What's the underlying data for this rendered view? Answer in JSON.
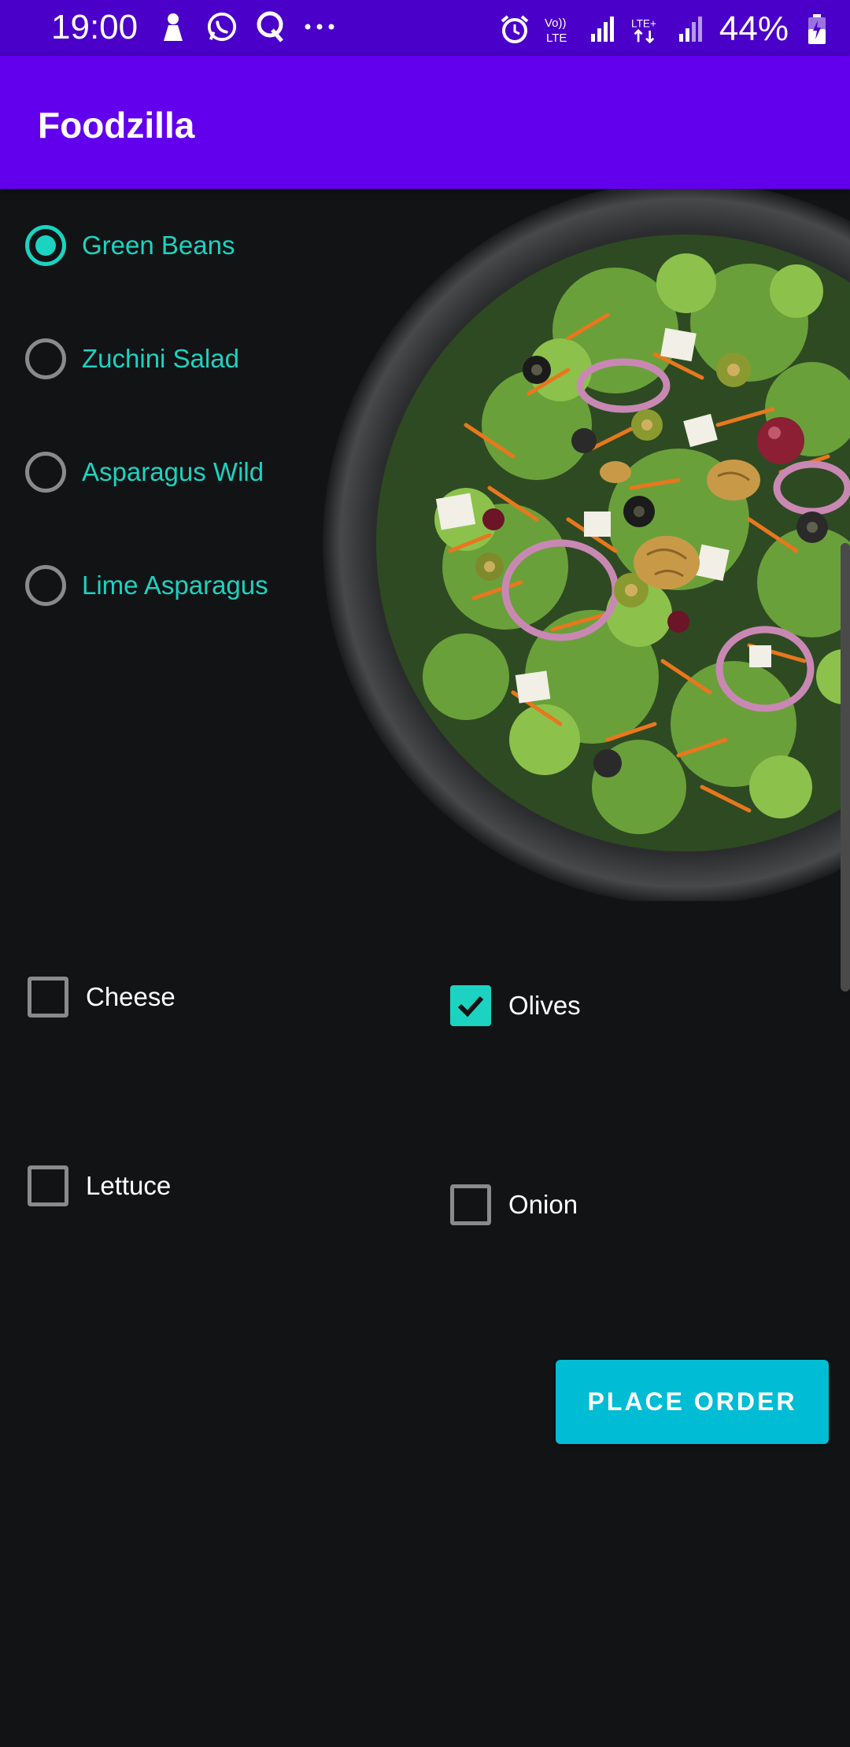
{
  "status_bar": {
    "time": "19:00",
    "battery_percent": "44%",
    "icons_left": [
      "notification-icon",
      "whatsapp-icon",
      "quora-icon",
      "more-icon"
    ],
    "icons_right": [
      "alarm-icon",
      "volte-icon",
      "signal-icon",
      "lte-plus-icon",
      "signal-icon",
      "battery-icon"
    ],
    "background": "#4a00c8"
  },
  "app_bar": {
    "title": "Foodzilla",
    "background": "#6200ee"
  },
  "salads": {
    "options": [
      {
        "label": "Green Beans",
        "selected": true
      },
      {
        "label": "Zuchini Salad",
        "selected": false
      },
      {
        "label": "Asparagus Wild",
        "selected": false
      },
      {
        "label": "Lime Asparagus",
        "selected": false
      }
    ],
    "accent": "#1bd3c0"
  },
  "toppings": [
    {
      "label": "Cheese",
      "checked": false
    },
    {
      "label": "Olives",
      "checked": true
    },
    {
      "label": "Lettuce",
      "checked": false
    },
    {
      "label": "Onion",
      "checked": false
    }
  ],
  "place_order_button": {
    "label": "PLACE ORDER",
    "color": "#00bcd4"
  }
}
